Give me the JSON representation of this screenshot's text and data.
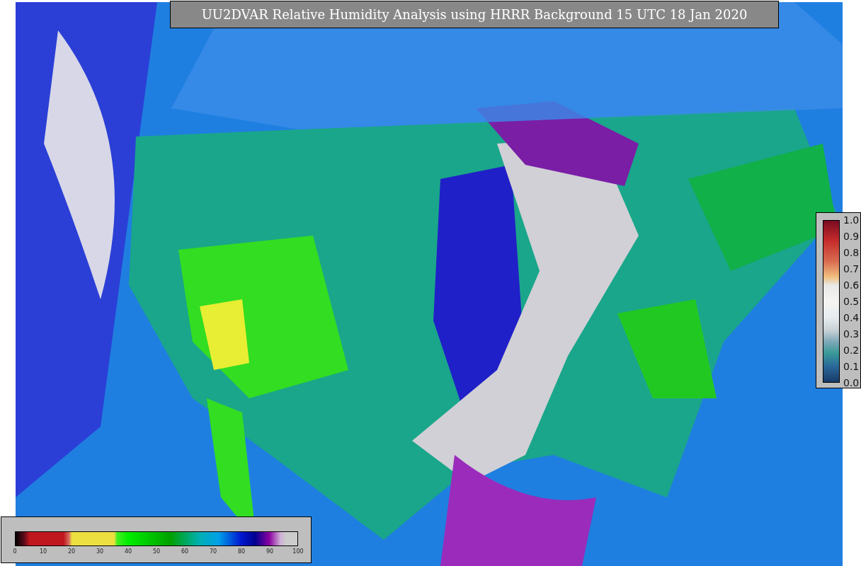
{
  "title": "UU2DVAR Relative Humidity Analysis using HRRR Background 15 UTC 18 Jan 2020",
  "humidity_colorbar": {
    "ticks": [
      "0",
      "10",
      "20",
      "30",
      "40",
      "50",
      "60",
      "70",
      "80",
      "90",
      "100"
    ]
  },
  "station_colorbar": {
    "ticks": [
      "1.0",
      "0.9",
      "0.8",
      "0.7",
      "0.6",
      "0.5",
      "0.4",
      "0.3",
      "0.2",
      "0.1",
      "0.0"
    ]
  }
}
